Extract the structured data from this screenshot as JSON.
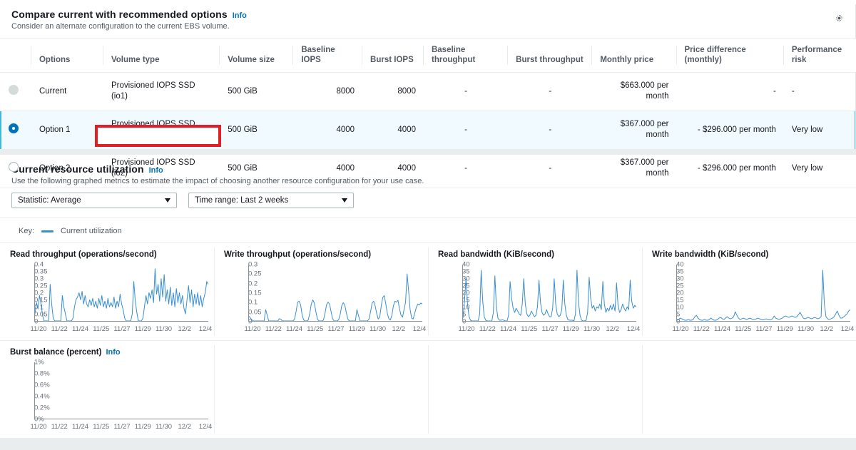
{
  "compare": {
    "title": "Compare current with recommended options",
    "info_label": "Info",
    "subtitle": "Consider an alternate configuration to the current EBS volume.",
    "settings_icon": "gear-icon",
    "columns": [
      "Options",
      "Volume type",
      "Volume size",
      "Baseline IOPS",
      "Burst IOPS",
      "Baseline throughput",
      "Burst throughput",
      "Monthly price",
      "Price difference (monthly)",
      "Performance risk"
    ],
    "rows": [
      {
        "radio_state": "disabled",
        "option": "Current",
        "volume_type": "Provisioned IOPS SSD (io1)",
        "volume_size": "500 GiB",
        "baseline_iops": "8000",
        "burst_iops": "8000",
        "baseline_throughput": "-",
        "burst_throughput": "-",
        "monthly_price": "$663.000 per month",
        "price_difference": "-",
        "performance_risk": "-",
        "selected": false,
        "annotated": false
      },
      {
        "radio_state": "on",
        "option": "Option 1",
        "volume_type": "Provisioned IOPS SSD (io1)",
        "volume_size": "500 GiB",
        "baseline_iops": "4000",
        "burst_iops": "4000",
        "baseline_throughput": "-",
        "burst_throughput": "-",
        "monthly_price": "$367.000 per month",
        "price_difference": "- $296.000 per month",
        "performance_risk": "Very low",
        "selected": true,
        "annotated": false
      },
      {
        "radio_state": "off",
        "option": "Option 2",
        "volume_type": "Provisioned IOPS SSD (io2)",
        "volume_size": "500 GiB",
        "baseline_iops": "4000",
        "burst_iops": "4000",
        "baseline_throughput": "-",
        "burst_throughput": "-",
        "monthly_price": "$367.000 per month",
        "price_difference": "- $296.000 per month",
        "performance_risk": "Very low",
        "selected": false,
        "annotated": true
      }
    ]
  },
  "utilization": {
    "title": "Current resource utilization",
    "info_label": "Info",
    "subtitle": "Use the following graphed metrics to estimate the impact of choosing another resource configuration for your use case.",
    "statistic_select": "Statistic: Average",
    "timerange_select": "Time range: Last 2 weeks",
    "key_label": "Key:",
    "key_series": "Current utilization",
    "line_color": "#3a8fd1"
  },
  "chart_data": [
    {
      "type": "line",
      "title": "Read throughput (operations/second)",
      "info": null,
      "xlabel": "",
      "ylabel": "",
      "ylim": [
        0,
        0.4
      ],
      "yticks": [
        "0",
        "0.05",
        "0.1",
        "0.15",
        "0.2",
        "0.25",
        "0.3",
        "0.35",
        "0.4"
      ],
      "ytick_values": [
        0,
        0.05,
        0.1,
        0.15,
        0.2,
        0.25,
        0.3,
        0.35,
        0.4
      ],
      "xticks": [
        "11/20",
        "11/22",
        "11/24",
        "11/25",
        "11/27",
        "11/29",
        "11/30",
        "12/2",
        "12/4"
      ],
      "grid": false,
      "series": [
        {
          "name": "Current utilization",
          "values": [
            0.05,
            0.13,
            0.09,
            0.18,
            0.12,
            0.04,
            0.0,
            0.0,
            0.0,
            0.0,
            0.26,
            0.12,
            0.02,
            0.0,
            0.0,
            0.0,
            0.0,
            0.0,
            0.18,
            0.1,
            0.05,
            0.0,
            0.0,
            0.0,
            0.0,
            0.02,
            0.1,
            0.15,
            0.17,
            0.2,
            0.15,
            0.21,
            0.12,
            0.18,
            0.12,
            0.1,
            0.15,
            0.11,
            0.16,
            0.1,
            0.14,
            0.09,
            0.16,
            0.11,
            0.18,
            0.1,
            0.14,
            0.09,
            0.16,
            0.1,
            0.13,
            0.1,
            0.17,
            0.09,
            0.14,
            0.1,
            0.19,
            0.12,
            0.08,
            0.02,
            0.0,
            0.0,
            0.0,
            0.0,
            0.05,
            0.28,
            0.14,
            0.06,
            0.0,
            0.0,
            0.0,
            0.02,
            0.1,
            0.18,
            0.12,
            0.2,
            0.16,
            0.22,
            0.13,
            0.37,
            0.19,
            0.26,
            0.14,
            0.3,
            0.17,
            0.33,
            0.14,
            0.22,
            0.12,
            0.24,
            0.11,
            0.2,
            0.1,
            0.23,
            0.13,
            0.2,
            0.12,
            0.18,
            0.09,
            0.05,
            0.15,
            0.25,
            0.13,
            0.22,
            0.1,
            0.19,
            0.12,
            0.2,
            0.11,
            0.18,
            0.1,
            0.16,
            0.2,
            0.28,
            0.26
          ]
        }
      ]
    },
    {
      "type": "line",
      "title": "Write throughput (operations/second)",
      "info": null,
      "xlabel": "",
      "ylabel": "",
      "ylim": [
        0,
        0.3
      ],
      "yticks": [
        "0",
        "0.05",
        "0.1",
        "0.15",
        "0.2",
        "0.25",
        "0.3"
      ],
      "ytick_values": [
        0,
        0.05,
        0.1,
        0.15,
        0.2,
        0.25,
        0.3
      ],
      "xticks": [
        "11/20",
        "11/22",
        "11/24",
        "11/25",
        "11/27",
        "11/29",
        "11/30",
        "12/2",
        "12/4"
      ],
      "grid": false,
      "series": [
        {
          "name": "Current utilization",
          "values": [
            0.025,
            0.015,
            0.005,
            0.0,
            0.0,
            0.0,
            0.0,
            0.0,
            0.0,
            0.0,
            0.0,
            0.06,
            0.03,
            0.0,
            0.0,
            0.0,
            0.0,
            0.0,
            0.0,
            0.0,
            0.012,
            0.008,
            0.0,
            0.0,
            0.0,
            0.0,
            0.0,
            0.0,
            0.0,
            0.0,
            0.01,
            0.05,
            0.1,
            0.105,
            0.085,
            0.03,
            0.005,
            0.0,
            0.0,
            0.005,
            0.04,
            0.09,
            0.112,
            0.095,
            0.05,
            0.01,
            0.0,
            0.0,
            0.0,
            0.005,
            0.04,
            0.085,
            0.1,
            0.09,
            0.05,
            0.012,
            0.0,
            0.0,
            0.0,
            0.006,
            0.035,
            0.08,
            0.097,
            0.085,
            0.045,
            0.01,
            0.0,
            0.0,
            0.0,
            0.0,
            0.0,
            0.06,
            0.03,
            0.0,
            0.0,
            0.0,
            0.0,
            0.0,
            0.0,
            0.01,
            0.05,
            0.095,
            0.105,
            0.08,
            0.04,
            0.01,
            0.02,
            0.08,
            0.125,
            0.135,
            0.09,
            0.04,
            0.012,
            0.005,
            0.03,
            0.08,
            0.105,
            0.1,
            0.11,
            0.065,
            0.03,
            0.02,
            0.06,
            0.1,
            0.25,
            0.16,
            0.06,
            0.015,
            0.01,
            0.04,
            0.07,
            0.09,
            0.085,
            0.095,
            0.09
          ]
        }
      ]
    },
    {
      "type": "line",
      "title": "Read bandwidth (KiB/second)",
      "info": null,
      "xlabel": "",
      "ylabel": "",
      "ylim": [
        0,
        40
      ],
      "yticks": [
        "0",
        "5",
        "10",
        "15",
        "20",
        "25",
        "30",
        "35",
        "40"
      ],
      "ytick_values": [
        0,
        5,
        10,
        15,
        20,
        25,
        30,
        35,
        40
      ],
      "xticks": [
        "11/20",
        "11/22",
        "11/24",
        "11/25",
        "11/27",
        "11/29",
        "11/30",
        "12/2",
        "12/4"
      ],
      "grid": false,
      "series": [
        {
          "name": "Current utilization",
          "values": [
            2,
            14,
            30,
            12,
            3,
            0.5,
            0,
            0,
            0,
            0,
            0,
            5,
            36,
            14,
            3,
            0.5,
            0,
            0,
            0,
            0,
            6,
            32,
            10,
            2,
            0.5,
            0.5,
            0.8,
            0.4,
            0,
            0,
            4,
            28,
            16,
            9,
            6,
            9,
            7,
            5,
            4,
            12,
            30,
            12,
            5,
            3,
            4,
            7,
            5,
            3,
            4,
            10,
            29,
            13,
            6,
            4,
            5,
            8,
            5,
            3,
            3,
            9,
            30,
            12,
            5,
            3,
            4,
            8,
            29,
            12,
            4,
            1,
            0.5,
            0.5,
            0.5,
            0,
            5,
            36,
            13,
            4,
            0.5,
            0,
            0,
            0.5,
            6,
            31,
            16,
            9,
            11,
            7,
            10,
            9,
            12,
            8,
            28,
            12,
            6,
            9,
            7,
            11,
            8,
            12,
            7,
            27,
            11,
            6,
            8,
            12,
            9,
            7,
            10,
            8,
            29,
            14,
            9,
            11,
            10
          ]
        }
      ]
    },
    {
      "type": "line",
      "title": "Write bandwidth (KiB/second)",
      "info": null,
      "xlabel": "",
      "ylabel": "",
      "ylim": [
        0,
        40
      ],
      "yticks": [
        "0",
        "5",
        "10",
        "15",
        "20",
        "25",
        "30",
        "35",
        "40"
      ],
      "ytick_values": [
        0,
        5,
        10,
        15,
        20,
        25,
        30,
        35,
        40
      ],
      "xticks": [
        "11/20",
        "11/22",
        "11/24",
        "11/25",
        "11/27",
        "11/29",
        "11/30",
        "12/2",
        "12/4"
      ],
      "grid": false,
      "series": [
        {
          "name": "Current utilization",
          "values": [
            0.5,
            1,
            2,
            1.5,
            0.8,
            0.5,
            0.5,
            1,
            0.5,
            0.5,
            1,
            3,
            4,
            2,
            1,
            0.5,
            0.5,
            1,
            0.5,
            0.5,
            1,
            2,
            1,
            0.5,
            0.5,
            1,
            2,
            2.5,
            1.5,
            1,
            2,
            3,
            2,
            1.5,
            2,
            3,
            6.5,
            4,
            2,
            1,
            1.5,
            2,
            1.5,
            1,
            1.5,
            2,
            1.5,
            1,
            1,
            1.5,
            2,
            1.5,
            1,
            0.8,
            1,
            1.5,
            1,
            0.8,
            1,
            1.5,
            3.5,
            2,
            1.5,
            1,
            1.5,
            2,
            3,
            3.5,
            3,
            2.5,
            3,
            3.5,
            3,
            2.5,
            3,
            4.5,
            6,
            4,
            2,
            1.5,
            2,
            2.5,
            2,
            1.5,
            2,
            2.5,
            2,
            1.5,
            2,
            3,
            36,
            12,
            3,
            1.5,
            1,
            1.5,
            2,
            3,
            5,
            7,
            4,
            2,
            2,
            3,
            4,
            5,
            7,
            8
          ]
        }
      ]
    },
    {
      "type": "line",
      "title": "Burst balance (percent)",
      "info": "Info",
      "xlabel": "",
      "ylabel": "",
      "ylim": [
        0,
        1
      ],
      "yticks": [
        "0%",
        "0.2%",
        "0.4%",
        "0.6%",
        "0.8%",
        "1%"
      ],
      "ytick_values": [
        0,
        0.2,
        0.4,
        0.6,
        0.8,
        1
      ],
      "xticks": [
        "11/20",
        "11/22",
        "11/24",
        "11/25",
        "11/27",
        "11/29",
        "11/30",
        "12/2",
        "12/4"
      ],
      "grid": false,
      "series": [
        {
          "name": "Current utilization",
          "values": []
        }
      ]
    }
  ]
}
